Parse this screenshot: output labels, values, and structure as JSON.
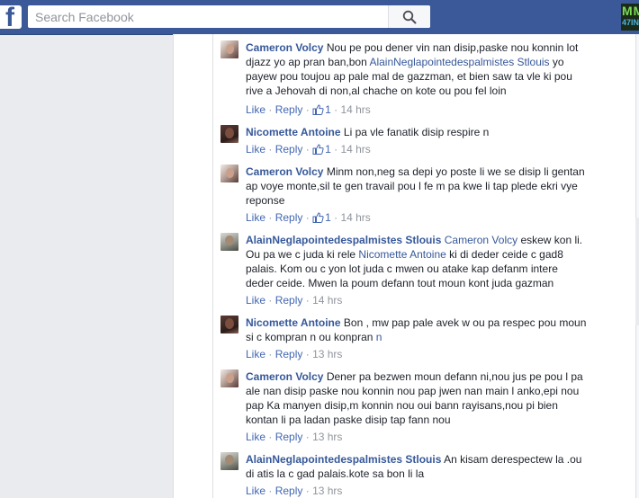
{
  "header": {
    "logo_letter": "f",
    "search_placeholder": "Search Facebook",
    "promo_line1": "MM",
    "promo_line2": "47INFO"
  },
  "labels": {
    "like": "Like",
    "reply": "Reply",
    "sep": "·"
  },
  "comments": [
    {
      "author": "Cameron Volcy",
      "avatar": "female",
      "text_before": " Nou pe pou dener vin nan disip,paske nou konnin lot djazz yo ap pran ban,bon ",
      "mention": "AlainNeglapointedespalmistes Stlouis",
      "text_after": " yo payew pou toujou ap pale mal de gazzman, et bien saw ta vle ki pou rive a Jehovah di non,al chache on kote ou pou fel loin",
      "likes": "1",
      "time": "14 hrs"
    },
    {
      "author": "Nicomette Antoine",
      "avatar": "dark",
      "text_before": " Li pa vle fanatik disip respire n",
      "mention": "",
      "text_after": "",
      "likes": "1",
      "time": "14 hrs"
    },
    {
      "author": "Cameron Volcy",
      "avatar": "female",
      "text_before": " Minm non,neg sa depi yo poste li we se disip li gentan ap voye monte,sil te gen travail pou l fe m pa kwe li tap plede ekri vye reponse",
      "mention": "",
      "text_after": "",
      "likes": "1",
      "time": "14 hrs"
    },
    {
      "author": "AlainNeglapointedespalmistes Stlouis",
      "avatar": "gray",
      "text_before": " ",
      "mention": "Cameron Volcy",
      "text_after": " eskew kon li. Ou pa we c juda ki rele ",
      "mention2": "Nicomette Antoine",
      "text_after2": " ki di deder ceide c gad8 palais. Kom ou c yon lot juda c mwen ou atake kap defanm intere deder ceide. Mwen la poum defann tout moun kont juda gazman",
      "likes": "",
      "time": "14 hrs"
    },
    {
      "author": "Nicomette Antoine",
      "avatar": "dark",
      "text_before": " Bon , mw pap pale avek w ou pa respec pou moun si c kompran n ou konpran ",
      "mention": "n",
      "text_after": "",
      "likes": "",
      "time": "13 hrs"
    },
    {
      "author": "Cameron Volcy",
      "avatar": "female",
      "text_before": " Dener pa bezwen moun defann ni,nou jus pe pou l pa ale nan disip paske nou konnin nou pap jwen nan main l anko,epi nou pap Ka manyen disip,m konnin nou oui bann rayisans,nou pi bien kontan li pa ladan paske disip tap fann nou",
      "mention": "",
      "text_after": "",
      "likes": "",
      "time": "13 hrs"
    },
    {
      "author": "AlainNeglapointedespalmistes Stlouis",
      "avatar": "gray",
      "text_before": " An kisam derespectew la .ou di atis la c gad palais.kote sa bon li la",
      "mention": "",
      "text_after": "",
      "likes": "",
      "time": "13 hrs"
    }
  ]
}
